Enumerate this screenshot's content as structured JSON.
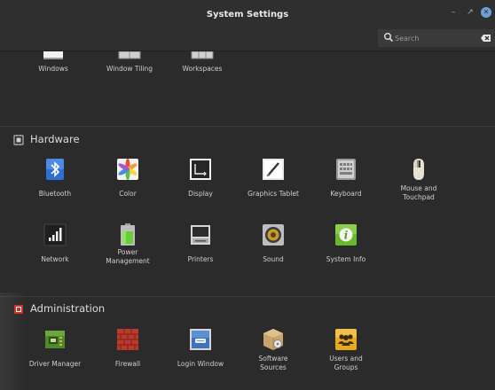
{
  "window": {
    "title": "System Settings"
  },
  "search": {
    "placeholder": "Search"
  },
  "top_row": [
    {
      "label": "Windows",
      "icon": "windows-icon"
    },
    {
      "label": "Window Tiling",
      "icon": "window-tiling-icon"
    },
    {
      "label": "Workspaces",
      "icon": "workspaces-icon"
    }
  ],
  "hardware": {
    "title": "Hardware",
    "items": [
      {
        "label": "Bluetooth",
        "icon": "bluetooth-icon"
      },
      {
        "label": "Color",
        "icon": "color-icon"
      },
      {
        "label": "Display",
        "icon": "display-icon"
      },
      {
        "label": "Graphics Tablet",
        "icon": "graphics-tablet-icon"
      },
      {
        "label": "Keyboard",
        "icon": "keyboard-icon"
      },
      {
        "label": "Mouse and\nTouchpad",
        "icon": "mouse-icon"
      },
      {
        "label": "Network",
        "icon": "network-icon"
      },
      {
        "label": "Power\nManagement",
        "icon": "battery-icon"
      },
      {
        "label": "Printers",
        "icon": "printer-icon"
      },
      {
        "label": "Sound",
        "icon": "speaker-icon"
      },
      {
        "label": "System Info",
        "icon": "info-icon"
      }
    ]
  },
  "administration": {
    "title": "Administration",
    "items": [
      {
        "label": "Driver Manager",
        "icon": "driver-manager-icon"
      },
      {
        "label": "Firewall",
        "icon": "firewall-icon"
      },
      {
        "label": "Login Window",
        "icon": "login-window-icon"
      },
      {
        "label": "Software\nSources",
        "icon": "software-sources-icon"
      },
      {
        "label": "Users and\nGroups",
        "icon": "users-groups-icon"
      }
    ]
  },
  "colors": {
    "background": "#2b2b2b",
    "titlebar": "#2f2f2f",
    "accent": "#6e9fd6"
  }
}
